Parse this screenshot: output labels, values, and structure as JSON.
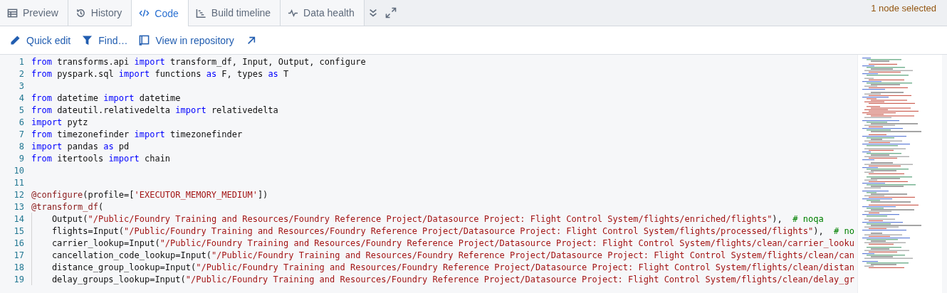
{
  "tabs": [
    {
      "label": "Preview",
      "selected": false
    },
    {
      "label": "History",
      "selected": false
    },
    {
      "label": "Code",
      "selected": true
    },
    {
      "label": "Build timeline",
      "selected": false
    },
    {
      "label": "Data health",
      "selected": false
    }
  ],
  "selection_status": "1 node selected",
  "toolbar": [
    {
      "label": "Quick edit"
    },
    {
      "label": "Find…"
    },
    {
      "label": "View in repository"
    }
  ],
  "code": {
    "lines": [
      {
        "number": "1",
        "tokens": [
          {
            "kind": "keyword",
            "text": "from"
          },
          {
            "kind": "plain",
            "text": " transforms.api "
          },
          {
            "kind": "keyword",
            "text": "import"
          },
          {
            "kind": "plain",
            "text": " transform_df, Input, Output, configure"
          }
        ]
      },
      {
        "number": "2",
        "tokens": [
          {
            "kind": "keyword",
            "text": "from"
          },
          {
            "kind": "plain",
            "text": " pyspark.sql "
          },
          {
            "kind": "keyword",
            "text": "import"
          },
          {
            "kind": "plain",
            "text": " functions "
          },
          {
            "kind": "keyword",
            "text": "as"
          },
          {
            "kind": "plain",
            "text": " F, types "
          },
          {
            "kind": "keyword",
            "text": "as"
          },
          {
            "kind": "plain",
            "text": " T"
          }
        ]
      },
      {
        "number": "3"
      },
      {
        "number": "4",
        "tokens": [
          {
            "kind": "keyword",
            "text": "from"
          },
          {
            "kind": "plain",
            "text": " datetime "
          },
          {
            "kind": "keyword",
            "text": "import"
          },
          {
            "kind": "plain",
            "text": " datetime"
          }
        ]
      },
      {
        "number": "5",
        "tokens": [
          {
            "kind": "keyword",
            "text": "from"
          },
          {
            "kind": "plain",
            "text": " dateutil.relativedelta "
          },
          {
            "kind": "keyword",
            "text": "import"
          },
          {
            "kind": "plain",
            "text": " relativedelta"
          }
        ]
      },
      {
        "number": "6",
        "tokens": [
          {
            "kind": "keyword",
            "text": "import"
          },
          {
            "kind": "plain",
            "text": " pytz"
          }
        ]
      },
      {
        "number": "7",
        "tokens": [
          {
            "kind": "keyword",
            "text": "from"
          },
          {
            "kind": "plain",
            "text": " timezonefinder "
          },
          {
            "kind": "keyword",
            "text": "import"
          },
          {
            "kind": "plain",
            "text": " timezonefinder"
          }
        ]
      },
      {
        "number": "8",
        "tokens": [
          {
            "kind": "keyword",
            "text": "import"
          },
          {
            "kind": "plain",
            "text": " pandas "
          },
          {
            "kind": "keyword",
            "text": "as"
          },
          {
            "kind": "plain",
            "text": " pd"
          }
        ]
      },
      {
        "number": "9",
        "tokens": [
          {
            "kind": "keyword",
            "text": "from"
          },
          {
            "kind": "plain",
            "text": " itertools "
          },
          {
            "kind": "keyword",
            "text": "import"
          },
          {
            "kind": "plain",
            "text": " chain"
          }
        ]
      },
      {
        "number": "10"
      },
      {
        "number": "11"
      },
      {
        "number": "12",
        "tokens": [
          {
            "kind": "decorator",
            "text": "@configure"
          },
          {
            "kind": "plain",
            "text": "(profile=["
          },
          {
            "kind": "string",
            "text": "'EXECUTOR_MEMORY_MEDIUM'"
          },
          {
            "kind": "plain",
            "text": "])"
          }
        ]
      },
      {
        "number": "13",
        "tokens": [
          {
            "kind": "decorator",
            "text": "@transform_df"
          },
          {
            "kind": "plain",
            "text": "("
          }
        ]
      },
      {
        "number": "14",
        "indented": true,
        "tokens": [
          {
            "kind": "plain",
            "text": "    Output("
          },
          {
            "kind": "string",
            "text": "\"/Public/Foundry Training and Resources/Foundry Reference Project/Datasource Project: Flight Control System/flights/enriched/flights\""
          },
          {
            "kind": "plain",
            "text": "),  "
          },
          {
            "kind": "comment",
            "text": "# noqa"
          }
        ]
      },
      {
        "number": "15",
        "indented": true,
        "tokens": [
          {
            "kind": "plain",
            "text": "    flights=Input("
          },
          {
            "kind": "string",
            "text": "\"/Public/Foundry Training and Resources/Foundry Reference Project/Datasource Project: Flight Control System/flights/processed/flights\""
          },
          {
            "kind": "plain",
            "text": "),  "
          },
          {
            "kind": "comment",
            "text": "# no"
          }
        ]
      },
      {
        "number": "16",
        "indented": true,
        "tokens": [
          {
            "kind": "plain",
            "text": "    carrier_lookup=Input("
          },
          {
            "kind": "string",
            "text": "\"/Public/Foundry Training and Resources/Foundry Reference Project/Datasource Project: Flight Control System/flights/clean/carrier_looku"
          }
        ]
      },
      {
        "number": "17",
        "indented": true,
        "tokens": [
          {
            "kind": "plain",
            "text": "    cancellation_code_lookup=Input("
          },
          {
            "kind": "string",
            "text": "\"/Public/Foundry Training and Resources/Foundry Reference Project/Datasource Project: Flight Control System/flights/clean/can"
          }
        ]
      },
      {
        "number": "18",
        "indented": true,
        "tokens": [
          {
            "kind": "plain",
            "text": "    distance_group_lookup=Input("
          },
          {
            "kind": "string",
            "text": "\"/Public/Foundry Training and Resources/Foundry Reference Project/Datasource Project: Flight Control System/flights/clean/distan"
          }
        ]
      },
      {
        "number": "19",
        "indented": true,
        "tokens": [
          {
            "kind": "plain",
            "text": "    delay_groups_lookup=Input("
          },
          {
            "kind": "string",
            "text": "\"/Public/Foundry Training and Resources/Foundry Reference Project/Datasource Project: Flight Control System/flights/clean/delay_gr"
          }
        ]
      }
    ]
  }
}
